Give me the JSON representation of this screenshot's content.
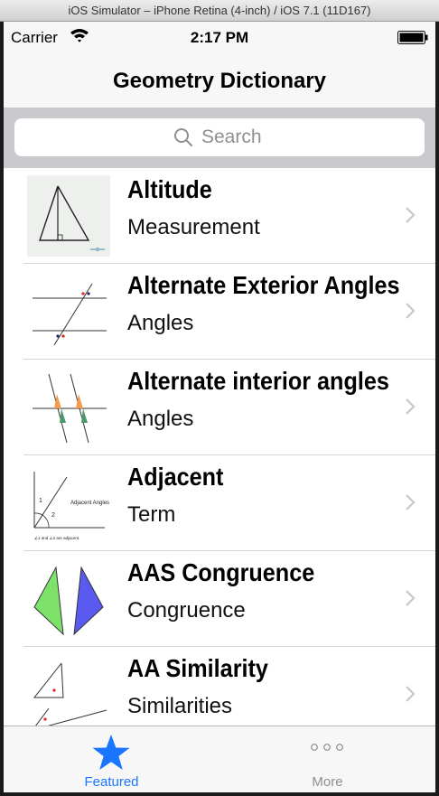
{
  "window": {
    "title": "iOS Simulator – iPhone Retina (4-inch) / iOS 7.1 (11D167)"
  },
  "status_bar": {
    "carrier": "Carrier",
    "time": "2:17 PM"
  },
  "nav": {
    "title": "Geometry Dictionary"
  },
  "search": {
    "placeholder": "Search"
  },
  "rows": [
    {
      "title": "Altitude",
      "subtitle": "Measurement",
      "thumbnail": "altitude-triangle-image"
    },
    {
      "title": "Alternate Exterior Angles",
      "subtitle": "Angles",
      "thumbnail": "parallel-lines-transversal-image"
    },
    {
      "title": "Alternate interior angles",
      "subtitle": "Angles",
      "thumbnail": "interior-angles-image"
    },
    {
      "title": "Adjacent",
      "subtitle": "Term",
      "thumbnail": "adjacent-angles-image",
      "thumb_text": {
        "heading": "Adjacent Angles",
        "n1": "1",
        "n2": "2",
        "caption": "∠1 and ∠2 are adjacent."
      }
    },
    {
      "title": "AAS Congruence",
      "subtitle": "Congruence",
      "thumbnail": "congruent-triangles-image"
    },
    {
      "title": "AA Similarity",
      "subtitle": "Similarities",
      "thumbnail": "similar-triangles-image"
    }
  ],
  "tabs": [
    {
      "label": "Featured",
      "icon": "star-icon",
      "selected": true,
      "color": "#1a75ff"
    },
    {
      "label": "More",
      "icon": "more-icon",
      "selected": false,
      "color": "#8e8e93"
    }
  ]
}
